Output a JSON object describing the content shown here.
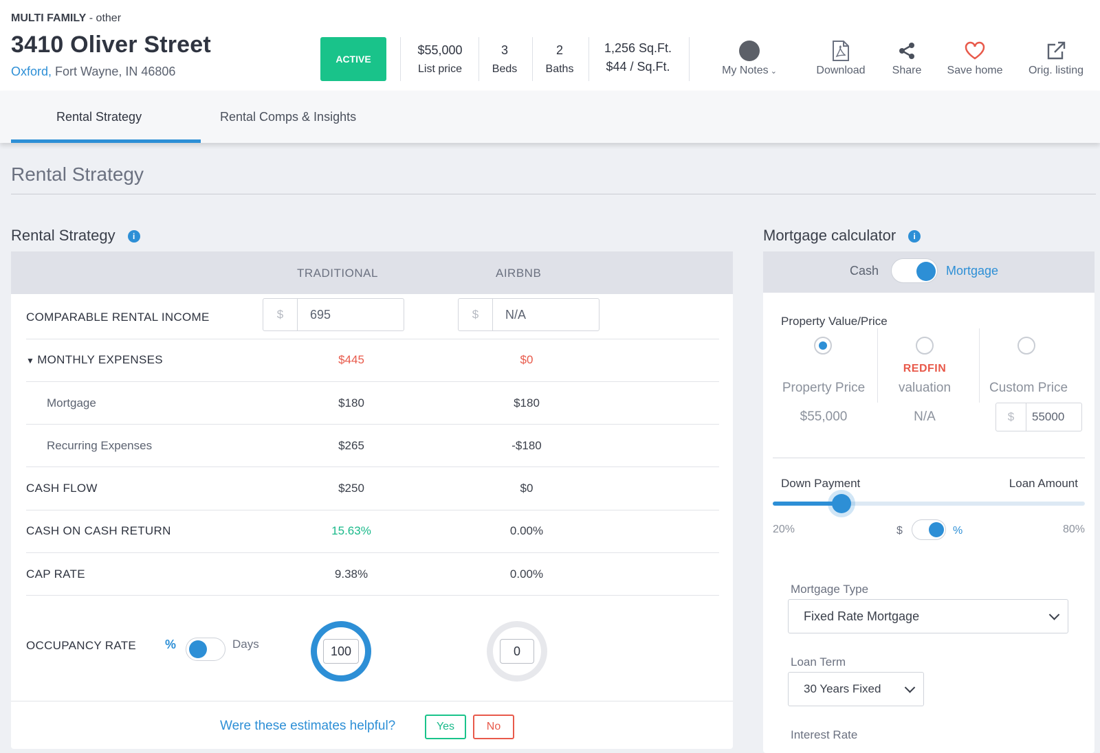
{
  "header": {
    "property_type": "MULTI FAMILY",
    "property_subtype": " - other",
    "title": "3410 Oliver Street",
    "city_link": "Oxford,",
    "address_rest": " Fort Wayne, IN 46806",
    "status": "ACTIVE",
    "price": "$55,000",
    "price_label": "List price",
    "beds": "3",
    "beds_label": "Beds",
    "baths": "2",
    "baths_label": "Baths",
    "sqft": "1,256 Sq.Ft.",
    "price_per_sqft": "$44 / Sq.Ft.",
    "actions": {
      "notes": "My Notes",
      "download": "Download",
      "share": "Share",
      "save": "Save home",
      "orig": "Orig. listing"
    }
  },
  "tabs": [
    "Rental Strategy",
    "Rental Comps & Insights"
  ],
  "page_heading": "Rental Strategy",
  "rental": {
    "title": "Rental Strategy",
    "col_traditional": "TRADITIONAL",
    "col_airbnb": "AIRBNB",
    "comparable_label": "COMPARABLE RENTAL INCOME",
    "currency": "$",
    "comparable_traditional": "695",
    "comparable_airbnb": "N/A",
    "expenses_label": "MONTHLY EXPENSES",
    "expenses_traditional": "$445",
    "expenses_airbnb": "$0",
    "mortgage_label": "Mortgage",
    "mortgage_traditional": "$180",
    "mortgage_airbnb": "$180",
    "recurring_label": "Recurring Expenses",
    "recurring_traditional": "$265",
    "recurring_airbnb": "-$180",
    "cashflow_label": "CASH FLOW",
    "cashflow_traditional": "$250",
    "cashflow_airbnb": "$0",
    "coc_label": "CASH ON CASH RETURN",
    "coc_traditional": "15.63%",
    "coc_airbnb": "0.00%",
    "cap_label": "CAP RATE",
    "cap_traditional": "9.38%",
    "cap_airbnb": "0.00%",
    "occupancy_label": "OCCUPANCY RATE",
    "occupancy_unit_pct": "%",
    "occupancy_unit_days": "Days",
    "occupancy_traditional": "100",
    "occupancy_airbnb": "0",
    "helpful_q": "Were these estimates helpful?",
    "yes": "Yes",
    "no": "No"
  },
  "mortgage": {
    "title": "Mortgage calculator",
    "cash": "Cash",
    "mortgage": "Mortgage",
    "value_label": "Property Value/Price",
    "opt_property": "Property Price",
    "opt_property_value": "$55,000",
    "opt_redfin_brand": "REDFIN",
    "opt_redfin": "valuation",
    "opt_redfin_value": "N/A",
    "opt_custom": "Custom Price",
    "custom_currency": "$",
    "custom_value": "55000",
    "down_payment": "Down Payment",
    "loan_amount": "Loan Amount",
    "slider_min": "20%",
    "slider_max": "80%",
    "unit_dollar": "$",
    "unit_pct": "%",
    "slider_level": 0.22,
    "type_label": "Mortgage Type",
    "type_value": "Fixed Rate Mortgage",
    "term_label": "Loan Term",
    "term_value": "30 Years Fixed",
    "rate_label": "Interest Rate"
  },
  "colors": {
    "accent": "#2d8fd6",
    "active": "#19c38a",
    "negative": "#e8594a",
    "positive": "#19b98a"
  }
}
